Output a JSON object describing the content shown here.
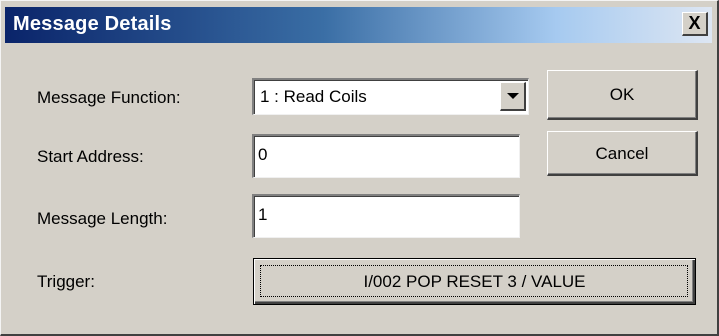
{
  "dialog": {
    "title": "Message Details",
    "close_label": "X"
  },
  "form": {
    "message_function": {
      "label": "Message Function:",
      "selected": "1 : Read Coils"
    },
    "start_address": {
      "label": "Start Address:",
      "value": "0"
    },
    "message_length": {
      "label": "Message Length:",
      "value": "1"
    },
    "trigger": {
      "label": "Trigger:",
      "button_text": "I/002 POP RESET 3 / VALUE"
    }
  },
  "buttons": {
    "ok": "OK",
    "cancel": "Cancel"
  },
  "icons": {
    "close": "close-icon",
    "dropdown": "chevron-down-icon"
  },
  "colors": {
    "title_start": "#0a246a",
    "title_end": "#dde6f3",
    "face": "#d4d0c8"
  }
}
